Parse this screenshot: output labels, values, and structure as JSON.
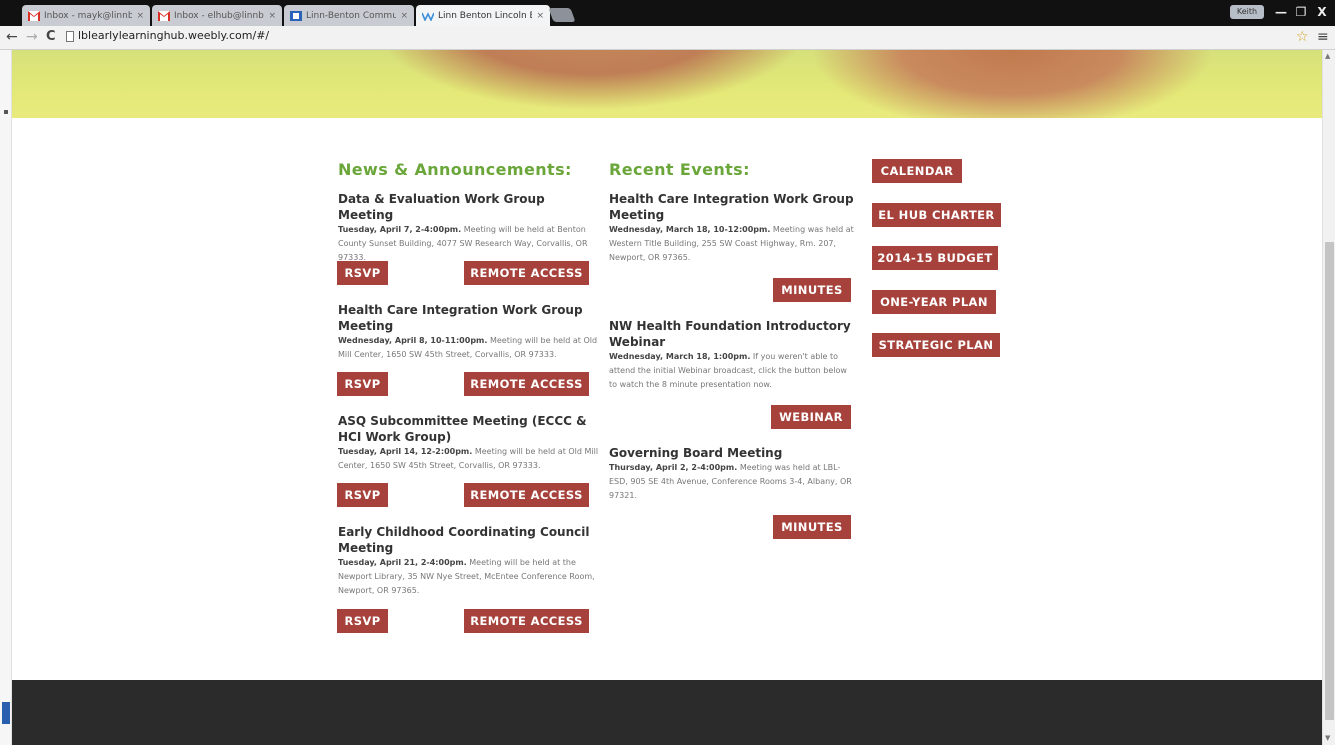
{
  "browser": {
    "tabs": [
      {
        "title": "Inbox - mayk@linnbenton...",
        "icon": "gmail-icon"
      },
      {
        "title": "Inbox - elhub@linnbenton...",
        "icon": "gmail-icon"
      },
      {
        "title": "Linn-Benton Community...",
        "icon": "site-icon"
      },
      {
        "title": "Linn Benton Lincoln Early",
        "icon": "weebly-icon"
      }
    ],
    "url": "lblearlylearninghub.weebly.com/#/",
    "user_badge": "Keith",
    "close_tab_glyph": "×",
    "window_controls": {
      "minimize": "—",
      "restore": "❐",
      "close": "X"
    },
    "nav": {
      "back": "←",
      "forward": "→",
      "reload": "C",
      "star": "☆",
      "menu": "≡"
    }
  },
  "news": {
    "heading": "News & Announcements:",
    "items": [
      {
        "title": "Data & Evaluation Work Group Meeting",
        "date": "Tuesday, April 7, 2-4:00pm.",
        "desc": "Meeting will be held at Benton County Sunset Building, 4077 SW Research Way, Corvallis, OR 97333.",
        "rsvp": "RSVP",
        "remote": "REMOTE ACCESS"
      },
      {
        "title": "Health Care Integration Work Group Meeting",
        "date": "Wednesday, April 8, 10-11:00pm.",
        "desc": "Meeting will be held at Old Mill Center, 1650 SW 45th Street, Corvallis, OR 97333.",
        "rsvp": "RSVP",
        "remote": "REMOTE ACCESS"
      },
      {
        "title": "ASQ Subcommittee Meeting (ECCC & HCI Work Group)",
        "date": "Tuesday, April 14, 12-2:00pm.",
        "desc": "Meeting will be held at Old Mill Center, 1650 SW 45th Street, Corvallis, OR 97333.",
        "rsvp": "RSVP",
        "remote": "REMOTE ACCESS"
      },
      {
        "title": "Early Childhood Coordinating Council Meeting",
        "date": "Tuesday, April 21, 2-4:00pm.",
        "desc": "Meeting will be held at the Newport Library, 35 NW Nye Street, McEntee Conference Room, Newport, OR 97365.",
        "rsvp": "RSVP",
        "remote": "REMOTE ACCESS"
      }
    ]
  },
  "events": {
    "heading": "Recent Events:",
    "items": [
      {
        "title": "Health Care Integration Work Group Meeting",
        "date": "Wednesday, March 18, 10-12:00pm.",
        "desc": "Meeting was held at Western Title Building, 255 SW Coast Highway, Rm. 207, Newport, OR 97365.",
        "button": "MINUTES"
      },
      {
        "title": "NW Health Foundation Introductory Webinar",
        "date": "Wednesday, March 18, 1:00pm.",
        "desc": "If you weren't able to attend the initial Webinar broadcast, click the button below to watch the 8 minute presentation now.",
        "button": "WEBINAR"
      },
      {
        "title": "Governing Board Meeting",
        "date": "Thursday, April 2, 2-4:00pm.",
        "desc": "Meeting was held at LBL-ESD, 905 SE 4th Avenue, Conference Rooms 3-4, Albany, OR 97321.",
        "button": "MINUTES"
      }
    ]
  },
  "sidebar": {
    "buttons": [
      "CALENDAR",
      "EL HUB CHARTER",
      "2014-15 BUDGET",
      "ONE-YEAR PLAN",
      "STRATEGIC PLAN"
    ]
  },
  "colors": {
    "heading_green": "#6aa63a",
    "button_red": "#a6423b",
    "footer": "#2b2b2b"
  }
}
